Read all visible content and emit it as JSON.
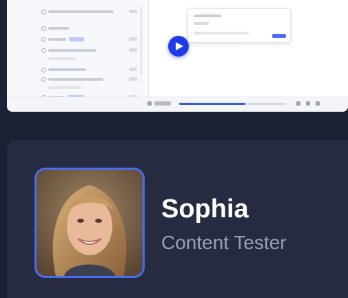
{
  "preview": {
    "play_icon": "play-icon",
    "accent": "#1f3be8",
    "progress": 0.62
  },
  "profile": {
    "name": "Sophia",
    "role": "Content Tester",
    "avatar_border_color": "#4a6df0",
    "avatar_description_icon": "avatar-photo"
  },
  "colors": {
    "page_background": "#1c2033",
    "card_background": "#272b42",
    "name_text": "#ffffff",
    "role_text": "#9a9fb3"
  }
}
